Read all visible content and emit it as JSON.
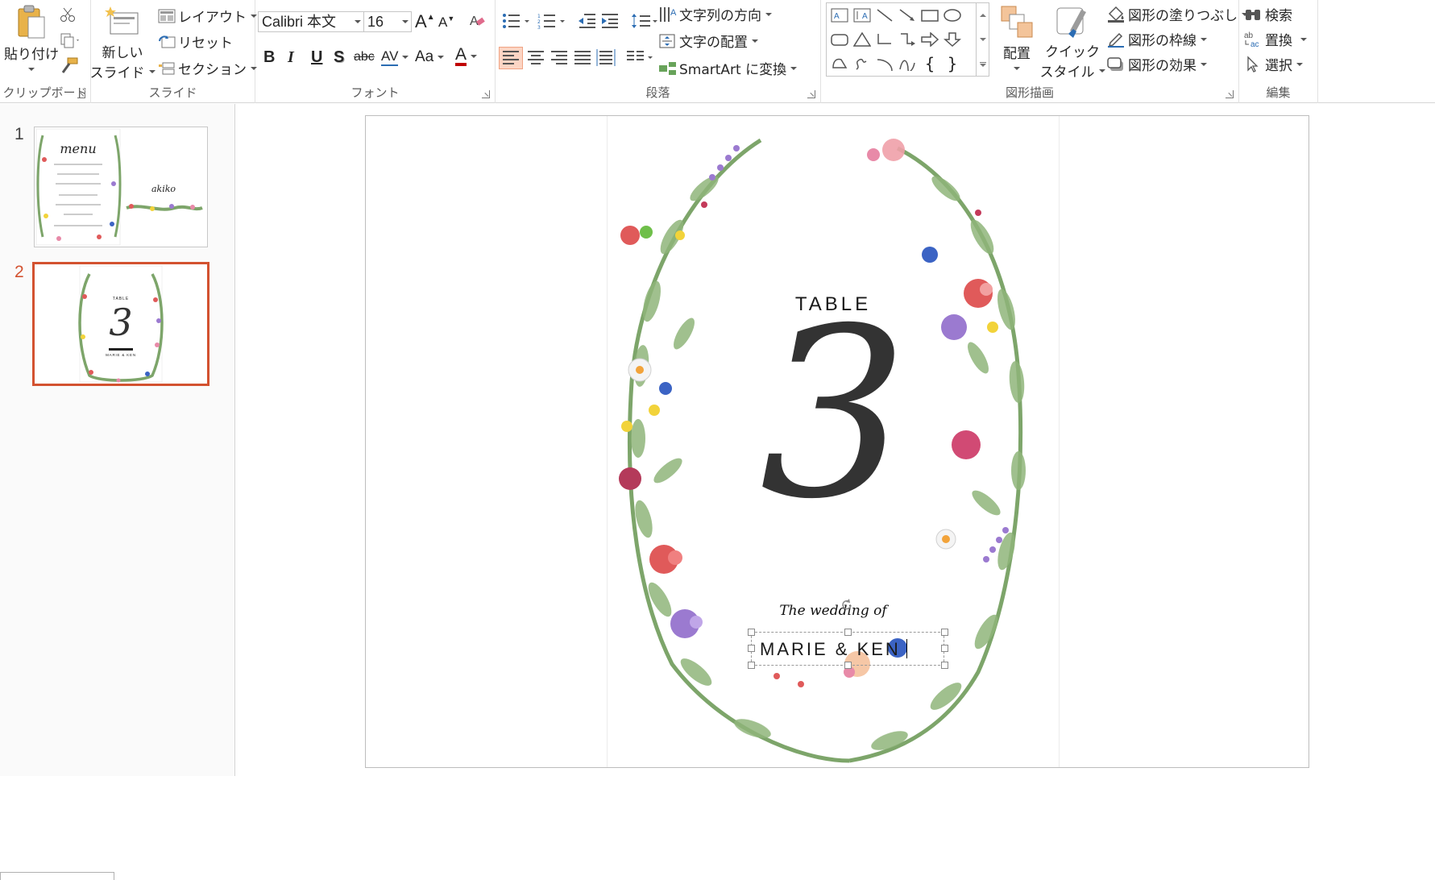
{
  "ribbon": {
    "clipboard": {
      "group_label": "クリップボード",
      "paste_label": "貼り付け"
    },
    "slides": {
      "group_label": "スライド",
      "new_slide_line1": "新しい",
      "new_slide_line2": "スライド",
      "layout": "レイアウト",
      "reset": "リセット",
      "section": "セクション"
    },
    "font": {
      "group_label": "フォント",
      "font_name": "Calibri 本文",
      "font_size": "16",
      "bold": "B",
      "italic": "I",
      "underline": "U",
      "shadow": "S",
      "strike": "abc",
      "spacing": "AV",
      "case": "Aa",
      "color": "A",
      "grow": "A",
      "shrink": "A"
    },
    "paragraph": {
      "group_label": "段落",
      "text_direction": "文字列の方向",
      "align_text": "文字の配置",
      "smartart": "SmartArt に変換"
    },
    "drawing": {
      "group_label": "図形描画",
      "arrange": "配置",
      "quick_styles_line1": "クイック",
      "quick_styles_line2": "スタイル",
      "shape_fill": "図形の塗りつぶし",
      "shape_outline": "図形の枠線",
      "shape_effects": "図形の効果"
    },
    "editing": {
      "group_label": "編集",
      "find": "検索",
      "replace": "置換",
      "select": "選択"
    }
  },
  "sidebar": {
    "slides": [
      {
        "number": "1",
        "title_script": "menu",
        "name_script": "akiko"
      },
      {
        "number": "2",
        "table_word": "TABLE",
        "numeral": "3",
        "names": "MARIE & KEN"
      }
    ]
  },
  "slide": {
    "table_word": "TABLE",
    "table_number": "3",
    "wedding_line": "The wedding of",
    "names": "MARIE & KEN"
  },
  "colors": {
    "accent": "#d35230",
    "paragraph_align_active": "#fcd5c4",
    "numeral": "#333333",
    "leaf_green": "#7da56a",
    "flower_red": "#e05a5a",
    "flower_purple": "#9b7ad0",
    "flower_blue": "#3b63c4",
    "flower_yellow": "#f2d33a",
    "flower_pink": "#e88aa8"
  }
}
